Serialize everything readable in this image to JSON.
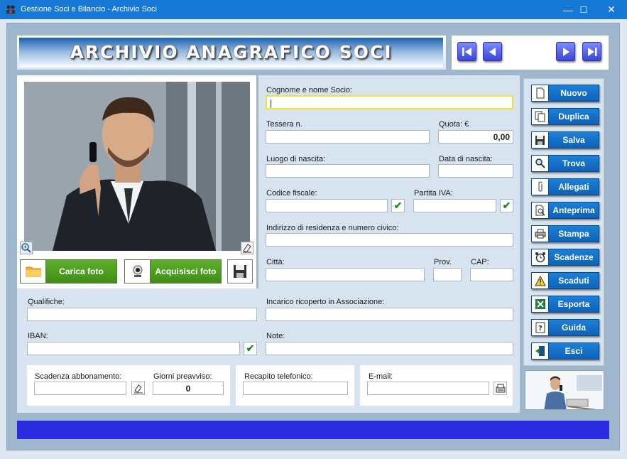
{
  "window": {
    "title": "Gestione Soci e Bilancio - Archivio Soci",
    "min": "—",
    "max": "☐",
    "close": "✕"
  },
  "banner": {
    "title": "ARCHIVIO ANAGRAFICO SOCI"
  },
  "photo": {
    "load_label": "Carica foto",
    "acquire_label": "Acquisisci foto"
  },
  "form": {
    "nome_label": "Cognome e nome Socio:",
    "nome_value": "",
    "tessera_label": "Tessera n.",
    "tessera_value": "",
    "quota_label": "Quota: €",
    "quota_value": "0,00",
    "luogo_label": "Luogo di nascita:",
    "data_label": "Data di nascita:",
    "cf_label": "Codice fiscale:",
    "piva_label": "Partita IVA:",
    "check_mark": "✔",
    "indirizzo_label": "Indirizzo di residenza e numero civico:",
    "citta_label": "Città:",
    "prov_label": "Prov.",
    "cap_label": "CAP:"
  },
  "lower": {
    "qualifiche_label": "Qualifiche:",
    "incarico_label": "Incarico ricoperto in Associazione:",
    "iban_label": "IBAN:",
    "note_label": "Note:"
  },
  "bottom": {
    "scadenza_label": "Scadenza abbonamento:",
    "giorni_label": "Giorni preavviso:",
    "giorni_value": "0",
    "recapito_label": "Recapito telefonico:",
    "email_label": "E-mail:"
  },
  "sidebar": {
    "items": [
      {
        "label": "Nuovo",
        "icon": "new-document-icon"
      },
      {
        "label": "Duplica",
        "icon": "duplicate-icon"
      },
      {
        "label": "Salva",
        "icon": "floppy-icon"
      },
      {
        "label": "Trova",
        "icon": "magnifier-icon"
      },
      {
        "label": "Allegati",
        "icon": "paperclip-icon"
      },
      {
        "label": "Anteprima",
        "icon": "preview-icon"
      },
      {
        "label": "Stampa",
        "icon": "printer-icon"
      },
      {
        "label": "Scadenze",
        "icon": "alarm-clock-icon"
      },
      {
        "label": "Scaduti",
        "icon": "warning-icon"
      },
      {
        "label": "Esporta",
        "icon": "excel-icon"
      },
      {
        "label": "Guida",
        "icon": "help-icon"
      },
      {
        "label": "Esci",
        "icon": "exit-icon"
      }
    ]
  },
  "colors": {
    "titlebar": "#1478d4",
    "statusbar": "#2d2de0",
    "side_button": "#1d7fd8",
    "green_button": "#4a9e20"
  }
}
